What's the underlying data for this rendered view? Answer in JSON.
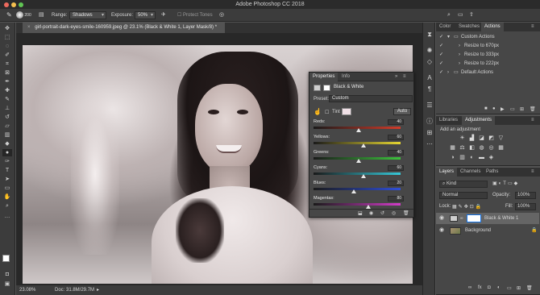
{
  "window": {
    "title": "Adobe Photoshop CC 2018"
  },
  "options_bar": {
    "brush_size": "200",
    "range_label": "Range:",
    "range_value": "Shadows",
    "exposure_label": "Exposure:",
    "exposure_value": "50%",
    "protect_tones": "Protect Tones"
  },
  "document": {
    "tab_title": "girl-portrait-dark-eyes-smile-160959.jpeg @ 23.1% (Black & White 1, Layer Mask/8) *",
    "zoom": "23.08%",
    "doc_size": "Doc: 31.8M/29.7M"
  },
  "properties": {
    "tabs": [
      "Properties",
      "Info"
    ],
    "title": "Black & White",
    "preset_label": "Preset:",
    "preset_value": "Custom",
    "tint_label": "Tint",
    "auto_label": "Auto",
    "sliders": [
      {
        "label": "Reds:",
        "value": "40"
      },
      {
        "label": "Yellows:",
        "value": "60"
      },
      {
        "label": "Greens:",
        "value": "40"
      },
      {
        "label": "Cyans:",
        "value": "60"
      },
      {
        "label": "Blues:",
        "value": "20"
      },
      {
        "label": "Magentas:",
        "value": "80"
      }
    ]
  },
  "actions_panel": {
    "tabs": [
      "Color",
      "Swatches",
      "Actions"
    ],
    "items": [
      "Custom Actions",
      "Resize to 670px",
      "Resize to 333px",
      "Resize to 222px",
      "Default Actions"
    ]
  },
  "adjustments_panel": {
    "tabs": [
      "Libraries",
      "Adjustments"
    ],
    "subtitle": "Add an adjustment"
  },
  "layers_panel": {
    "tabs": [
      "Layers",
      "Channels",
      "Paths"
    ],
    "filter_label": "Kind",
    "blend_mode": "Normal",
    "opacity_label": "Opacity:",
    "opacity_value": "100%",
    "lock_label": "Lock:",
    "fill_label": "Fill:",
    "fill_value": "100%",
    "layers": [
      "Black & White 1",
      "Background"
    ]
  },
  "colors": {
    "accent": "#1473e6",
    "panel_bg": "#474747",
    "dark_bg": "#3c3c3c"
  }
}
